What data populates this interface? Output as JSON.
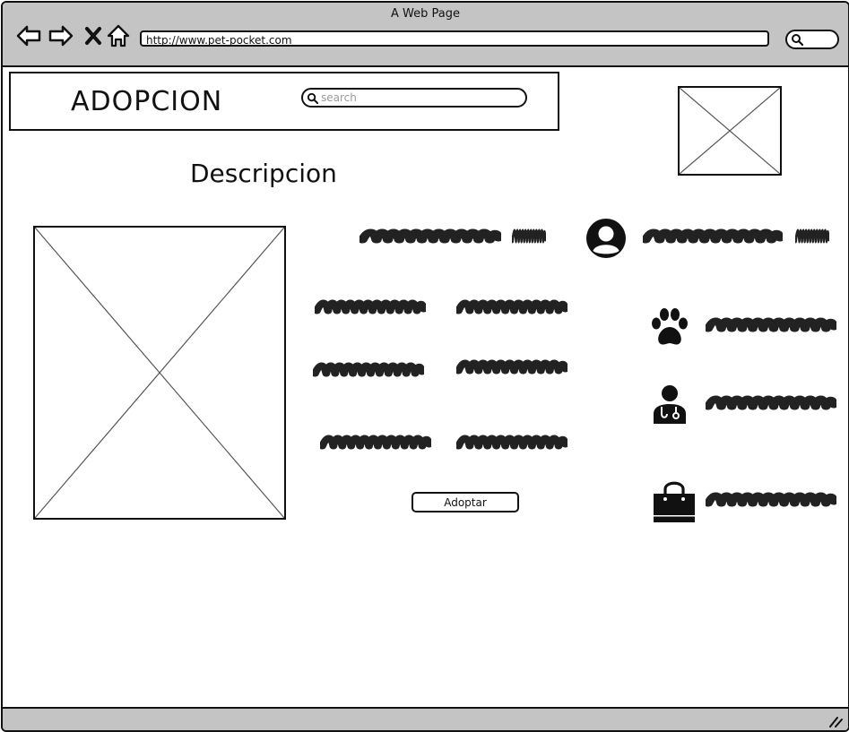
{
  "window": {
    "title": "A Web Page",
    "url": "http://www.pet-pocket.com"
  },
  "header": {
    "brand": "ADOPCION",
    "search_placeholder": "search"
  },
  "content": {
    "title": "Descripcion",
    "adopt_button_label": "Adoptar"
  },
  "icons": {
    "back": "back-arrow-icon",
    "forward": "forward-arrow-icon",
    "stop": "close-icon",
    "home": "home-icon",
    "search": "search-icon",
    "owner": "user-avatar-icon",
    "pet": "paw-icon",
    "vet": "doctor-icon",
    "shop": "shopping-bag-icon"
  },
  "colors": {
    "chrome": "#c4c4c4",
    "ink": "#111111",
    "placeholder_line": "#555555"
  }
}
